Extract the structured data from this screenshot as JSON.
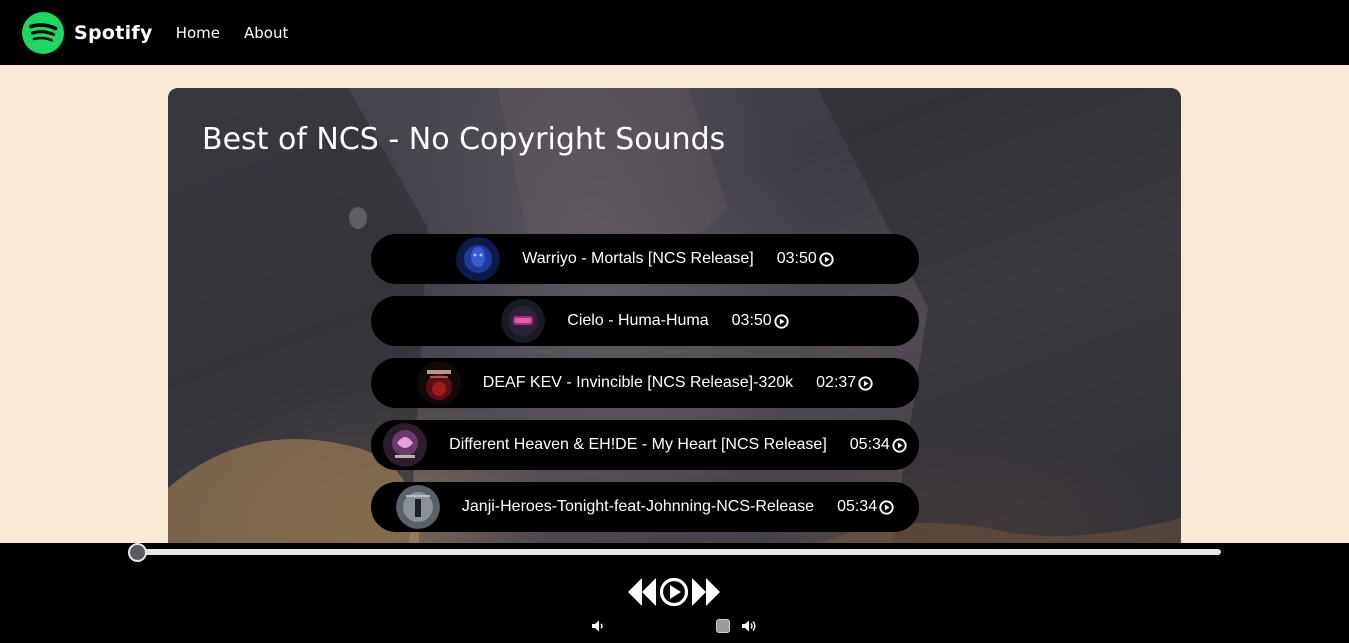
{
  "nav": {
    "brand": "Spotify",
    "links": [
      "Home",
      "About"
    ]
  },
  "playlist": {
    "title": "Best of NCS - No Copyright Sounds",
    "songs": [
      {
        "name": "Warriyo - Mortals [NCS Release]",
        "duration": "03:50"
      },
      {
        "name": "Cielo - Huma-Huma",
        "duration": "03:50"
      },
      {
        "name": "DEAF KEV - Invincible [NCS Release]-320k",
        "duration": "02:37"
      },
      {
        "name": "Different Heaven & EH!DE - My Heart [NCS Release]",
        "duration": "05:34"
      },
      {
        "name": "Janji-Heroes-Tonight-feat-Johnning-NCS-Release",
        "duration": "05:34"
      }
    ]
  },
  "player": {
    "progress": 0,
    "volume": 0.75
  },
  "colors": {
    "navbar": "#000000",
    "page_background": "#faebd7",
    "brand_green": "#1ed760",
    "song_row": "#000000"
  },
  "icons": [
    "spotify-logo-icon",
    "play-circle-icon",
    "previous-icon",
    "next-icon",
    "volume-down-icon",
    "volume-up-icon"
  ]
}
